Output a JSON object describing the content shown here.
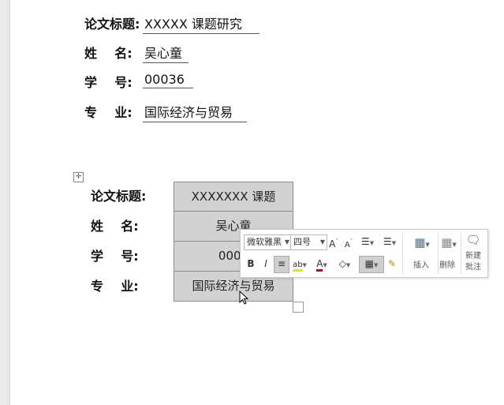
{
  "form": [
    {
      "label": "论文标题:",
      "value": "XXXXX 课题研究"
    },
    {
      "label": "姓    名:",
      "value": "吴心童"
    },
    {
      "label": "学    号:",
      "value": "00036"
    },
    {
      "label": "专    业:",
      "value": "国际经济与贸易"
    }
  ],
  "table": {
    "move_handle": "✛",
    "rows": [
      {
        "label": "论文标题:",
        "value": "XXXXXXX 课题"
      },
      {
        "label": "姓    名:",
        "value": "吴心童"
      },
      {
        "label": "学    号:",
        "value": "0003"
      },
      {
        "label": "专    业:",
        "value": "国际经济与贸易"
      }
    ]
  },
  "mini_toolbar": {
    "font_name": "微软雅黑",
    "font_size": "四号",
    "grow_font": "A",
    "shrink_font": "A",
    "bullets": "☰",
    "numbering": "☰",
    "bold": "B",
    "italic": "I",
    "center": "≡",
    "highlight": "ab",
    "font_color": "A",
    "shading": "◇",
    "borders": "▦",
    "format_painter": "✎",
    "insert_label": "插入",
    "delete_label": "删除",
    "new_comment_line1": "新建",
    "new_comment_line2": "批注",
    "colors": {
      "highlight": "#f2e300",
      "font_color": "#d40000"
    }
  }
}
